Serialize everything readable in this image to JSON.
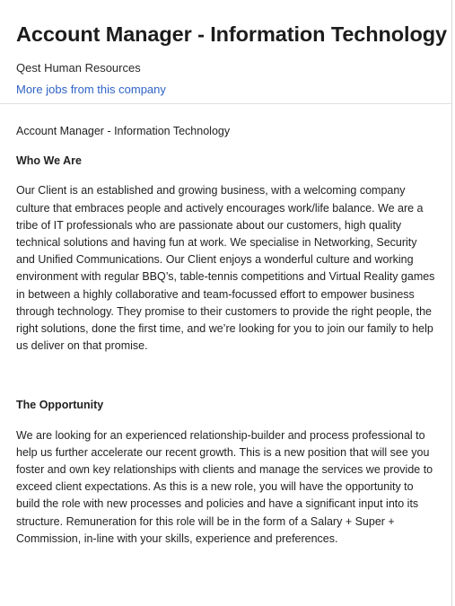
{
  "header": {
    "title": "Account Manager - Information Technology",
    "company": "Qest Human Resources",
    "more_jobs_link": "More jobs from this company"
  },
  "content": {
    "intro_line": "Account Manager - Information Technology",
    "sections": [
      {
        "heading": "Who We Are",
        "body": "Our Client is an established and growing business, with a welcoming company culture that embraces people and actively encourages work/life balance. We are a tribe of IT professionals who are passionate about our customers, high quality technical solutions and having fun at work. We specialise in Networking, Security and Unified Communications. Our Client enjoys a wonderful culture and working environment with regular BBQ’s, table-tennis competitions and Virtual Reality games in between a highly collaborative and team-focussed effort to empower business through technology. They promise to their customers to provide the right people, the right solutions, done the first time, and we’re looking for you to join our family to help us deliver on that promise."
      },
      {
        "heading": "The Opportunity",
        "body": "We are looking for an experienced relationship-builder and process professional to help us further accelerate our recent growth. This is a new position that will see you foster and own key relationships with clients and manage the services we provide to exceed client expectations. As this is a new role, you will have the opportunity to build the role with new processes and policies and have a significant input into its structure. Remuneration for this role will be in the form of a Salary + Super + Commission, in-line with your skills, experience and preferences."
      }
    ]
  }
}
